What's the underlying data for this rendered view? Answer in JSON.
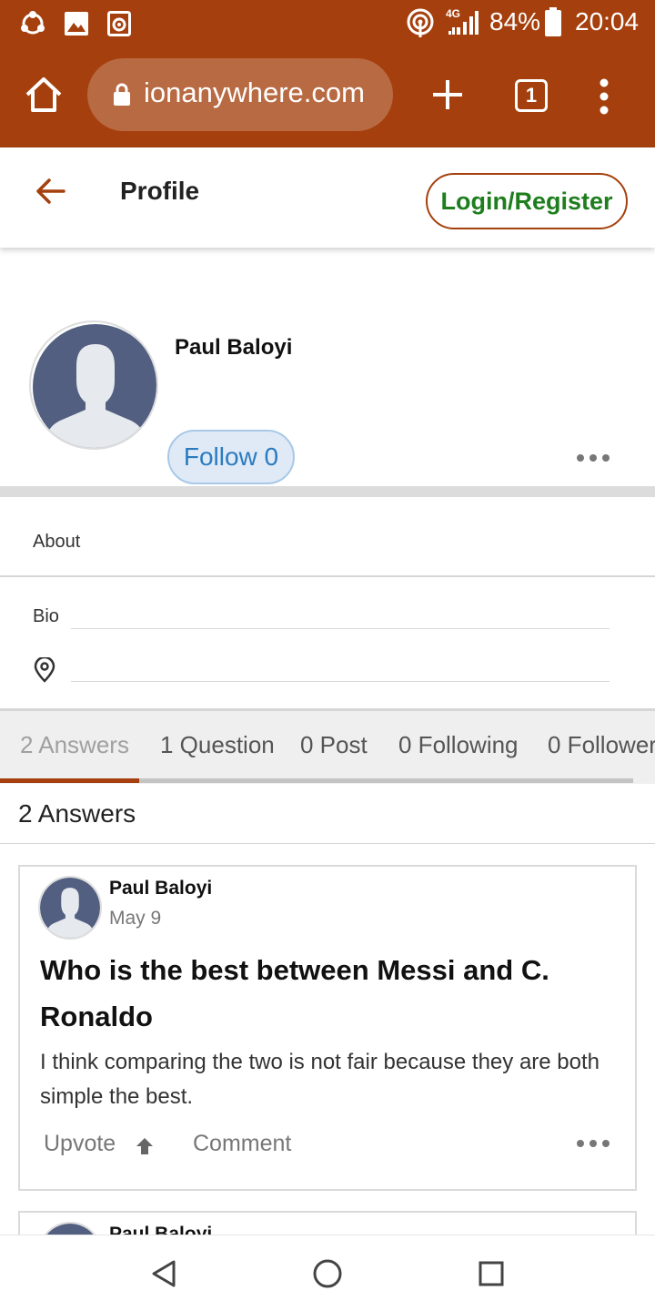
{
  "status_bar": {
    "network": "4G",
    "battery": "84%",
    "time": "20:04"
  },
  "browser": {
    "url": "ionanywhere.com",
    "tab_count": "1"
  },
  "header": {
    "title": "Profile",
    "login_label": "Login/Register"
  },
  "profile": {
    "name": "Paul Baloyi",
    "follow_label": "Follow 0"
  },
  "about": {
    "heading": "About",
    "bio_label": "Bio",
    "bio_value": "",
    "location_value": ""
  },
  "stats": {
    "tabs": [
      "2 Answers",
      "1 Question",
      "0 Post",
      "0 Following",
      "0 Follower"
    ],
    "active_index": 0
  },
  "section_title": "2 Answers",
  "answers": [
    {
      "author": "Paul Baloyi",
      "date": "May 9",
      "question": "Who is the best between Messi and C. Ronaldo",
      "answer": "I think comparing the two is not fair because they are both simple the best.",
      "upvote_label": "Upvote",
      "comment_label": "Comment"
    },
    {
      "author": "Paul Baloyi"
    }
  ],
  "colors": {
    "brand": "#a5400e",
    "login_text": "#1e7e1e",
    "follow_bg": "#dfeaf6",
    "follow_text": "#2b7bc0",
    "avatar": "#525f80"
  },
  "icons": [
    "palette-icon",
    "image-icon",
    "camera-icon",
    "hotspot-icon",
    "signal-icon",
    "battery-icon",
    "home-icon",
    "lock-icon",
    "plus-icon",
    "tabs-icon",
    "menu-icon",
    "back-arrow-icon",
    "more-icon",
    "location-icon",
    "upvote-arrow-icon",
    "back-nav-icon",
    "home-nav-icon",
    "recents-nav-icon"
  ]
}
